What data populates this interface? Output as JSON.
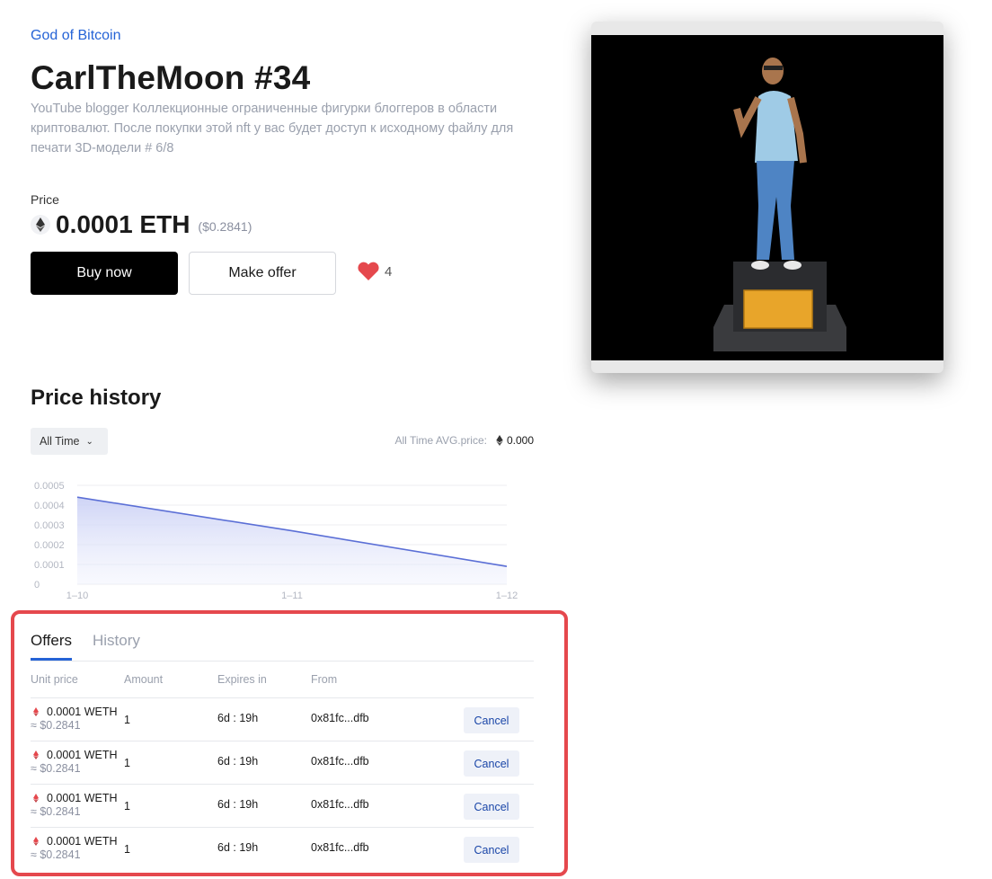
{
  "collection": "God of Bitcoin",
  "title": "CarlTheMoon #34",
  "description": "YouTube blogger Коллекционные ограниченные фигурки блоггеров в области криптовалют. После покупки этой nft у вас будет доступ к исходному файлу для печати 3D-модели # 6/8",
  "price": {
    "label": "Price",
    "amount": "0.0001 ETH",
    "usd": "($0.2841)"
  },
  "actions": {
    "buy_label": "Buy now",
    "offer_label": "Make offer",
    "like_count": "4"
  },
  "price_history": {
    "title": "Price history",
    "range_select": "All Time",
    "avg_label": "All Time AVG.price:",
    "avg_value": "0.000"
  },
  "chart_data": {
    "type": "area",
    "x": [
      "1-10",
      "1-11",
      "1-12"
    ],
    "values": [
      0.00044,
      0.00027,
      9e-05
    ],
    "ylim": [
      0,
      0.0005
    ],
    "yticks": [
      "0.0005",
      "0.0004",
      "0.0003",
      "0.0002",
      "0.0001",
      "0"
    ],
    "xticks": [
      "1–10",
      "1–11",
      "1–12"
    ],
    "grid": true,
    "line_color": "#5b6fd6"
  },
  "offers": {
    "tabs": [
      "Offers",
      "History"
    ],
    "columns": [
      "Unit price",
      "Amount",
      "Expires in",
      "From"
    ],
    "rows": [
      {
        "price": "0.0001 WETH",
        "usd": "≈ $0.2841",
        "amount": "1",
        "expires": "6d : 19h",
        "from": "0x81fc...dfb",
        "action": "Cancel"
      },
      {
        "price": "0.0001 WETH",
        "usd": "≈ $0.2841",
        "amount": "1",
        "expires": "6d : 19h",
        "from": "0x81fc...dfb",
        "action": "Cancel"
      },
      {
        "price": "0.0001 WETH",
        "usd": "≈ $0.2841",
        "amount": "1",
        "expires": "6d : 19h",
        "from": "0x81fc...dfb",
        "action": "Cancel"
      },
      {
        "price": "0.0001 WETH",
        "usd": "≈ $0.2841",
        "amount": "1",
        "expires": "6d : 19h",
        "from": "0x81fc...dfb",
        "action": "Cancel"
      }
    ]
  },
  "colors": {
    "accent": "#2563d6",
    "highlight_box": "#e5484d",
    "heart": "#e5484d"
  },
  "icons": {
    "eth": "ethereum-icon",
    "weth": "weth-icon",
    "heart": "heart-icon",
    "chevron": "chevron-down-icon"
  }
}
